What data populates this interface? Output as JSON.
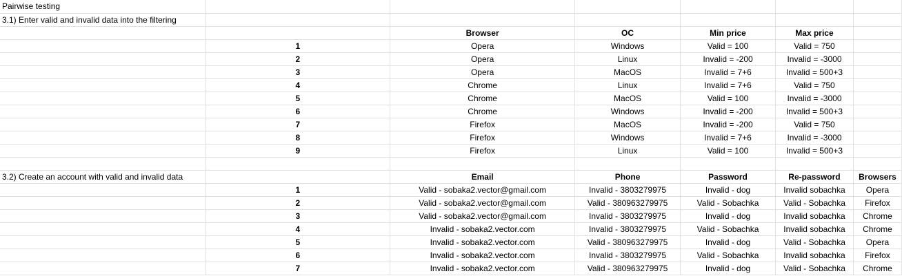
{
  "title": "Pairwise testing",
  "section1": {
    "label": "3.1) Enter valid and invalid data into the filtering",
    "headers": [
      "Browser",
      "OC",
      "Min price",
      "Max price"
    ],
    "rows": [
      {
        "n": "1",
        "browser": "Opera",
        "os": "Windows",
        "min": "Valid = 100",
        "max": "Valid = 750"
      },
      {
        "n": "2",
        "browser": "Opera",
        "os": "Linux",
        "min": "Invalid = -200",
        "max": "Invalid = -3000"
      },
      {
        "n": "3",
        "browser": "Opera",
        "os": "MacOS",
        "min": "Invalid = 7+6",
        "max": "Invalid = 500+3"
      },
      {
        "n": "4",
        "browser": "Chrome",
        "os": "Linux",
        "min": "Invalid = 7+6",
        "max": "Valid = 750"
      },
      {
        "n": "5",
        "browser": "Chrome",
        "os": "MacOS",
        "min": "Valid = 100",
        "max": "Invalid = -3000"
      },
      {
        "n": "6",
        "browser": "Chrome",
        "os": "Windows",
        "min": "Invalid = -200",
        "max": "Invalid = 500+3"
      },
      {
        "n": "7",
        "browser": "Firefox",
        "os": "MacOS",
        "min": "Invalid = -200",
        "max": "Valid = 750"
      },
      {
        "n": "8",
        "browser": "Firefox",
        "os": "Windows",
        "min": "Invalid = 7+6",
        "max": "Invalid = -3000"
      },
      {
        "n": "9",
        "browser": "Firefox",
        "os": "Linux",
        "min": "Valid = 100",
        "max": "Invalid = 500+3"
      }
    ]
  },
  "section2": {
    "label": "3.2) Create an account with valid and invalid data",
    "headers": [
      "Email",
      "Phone",
      "Password",
      "Re-password",
      "Browsers"
    ],
    "rows": [
      {
        "n": "1",
        "email": "Valid - sobaka2.vector@gmail.com",
        "phone": "Invalid - 3803279975",
        "pass": "Invalid - dog",
        "repass": "Invalid sobachka",
        "browser": "Opera"
      },
      {
        "n": "2",
        "email": "Valid - sobaka2.vector@gmail.com",
        "phone": "Valid - 380963279975",
        "pass": "Valid - Sobachka",
        "repass": "Valid - Sobachka",
        "browser": "Firefox"
      },
      {
        "n": "3",
        "email": "Valid - sobaka2.vector@gmail.com",
        "phone": "Invalid - 3803279975",
        "pass": "Invalid - dog",
        "repass": "Invalid sobachka",
        "browser": "Chrome"
      },
      {
        "n": "4",
        "email": "Invalid - sobaka2.vector.com",
        "phone": "Invalid - 3803279975",
        "pass": "Valid - Sobachka",
        "repass": "Invalid sobachka",
        "browser": "Chrome"
      },
      {
        "n": "5",
        "email": "Invalid - sobaka2.vector.com",
        "phone": "Valid - 380963279975",
        "pass": "Invalid - dog",
        "repass": "Valid - Sobachka",
        "browser": "Opera"
      },
      {
        "n": "6",
        "email": "Invalid - sobaka2.vector.com",
        "phone": "Invalid - 3803279975",
        "pass": "Valid - Sobachka",
        "repass": "Invalid sobachka",
        "browser": "Firefox"
      },
      {
        "n": "7",
        "email": "Invalid - sobaka2.vector.com",
        "phone": "Valid - 380963279975",
        "pass": "Invalid - dog",
        "repass": "Valid - Sobachka",
        "browser": "Chrome"
      }
    ]
  }
}
